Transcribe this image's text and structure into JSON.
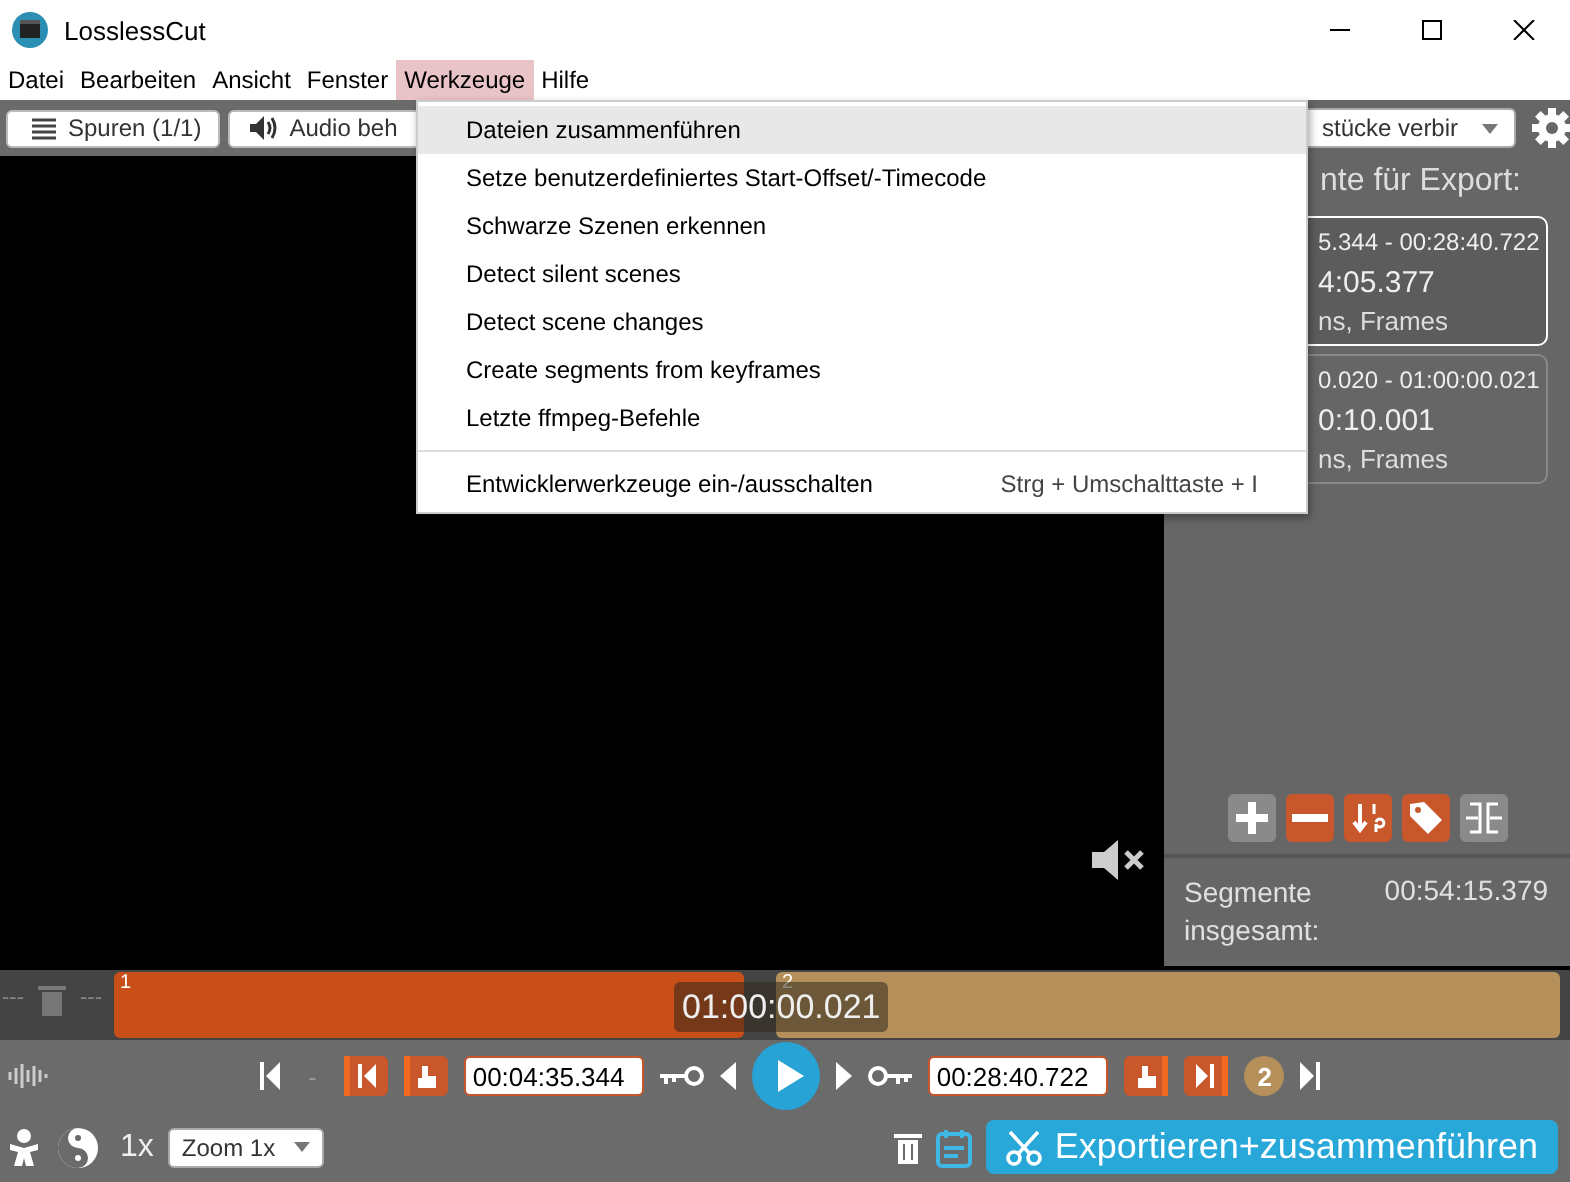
{
  "window": {
    "title": "LosslessCut"
  },
  "menu_bar": [
    {
      "label": "Datei",
      "selected": false
    },
    {
      "label": "Bearbeiten",
      "selected": false
    },
    {
      "label": "Ansicht",
      "selected": false
    },
    {
      "label": "Fenster",
      "selected": false
    },
    {
      "label": "Werkzeuge",
      "selected": true
    },
    {
      "label": "Hilfe",
      "selected": false
    }
  ],
  "toolbar": {
    "buttons": [
      "Spuren (1/1)",
      "Audio beh"
    ],
    "dropdown": "stücke verbir"
  },
  "dropdown_menu": [
    {
      "label": "Dateien zusammenführen",
      "selected": true,
      "separator_before": false
    },
    {
      "label": "Setze benutzerdefiniertes Start-Offset/-Timecode",
      "selected": false,
      "separator_before": false
    },
    {
      "label": "Schwarze Szenen erkennen",
      "selected": false,
      "separator_before": false
    },
    {
      "label": "Detect silent scenes",
      "selected": false,
      "separator_before": false
    },
    {
      "label": "Detect scene changes",
      "selected": false,
      "separator_before": false
    },
    {
      "label": "Create segments from keyframes",
      "selected": false,
      "separator_before": false
    },
    {
      "label": "Letzte ffmpeg-Befehle",
      "selected": false,
      "separator_before": false
    },
    {
      "label": "Entwicklerwerkzeuge ein-/ausschalten",
      "shortcut": "Strg + Umschalttaste + I",
      "selected": false,
      "separator_before": true
    }
  ],
  "sidebar": {
    "heading": "nte für Export:",
    "segments": [
      {
        "range": "5.344 - 00:28:40.722",
        "duration": "4:05.377",
        "note": "ns, Frames",
        "selected": true
      },
      {
        "range": "0.020 - 01:00:00.021",
        "duration": "0:10.001",
        "note": "ns, Frames",
        "selected": false
      }
    ],
    "total_label": "Segmente insgesamt:",
    "total": "00:54:15.379"
  },
  "timeline": {
    "dashes": [
      "---",
      "---"
    ],
    "segments": [
      {
        "label": "1",
        "color": "#c84f17"
      },
      {
        "label": "2",
        "color": "#b5905b"
      }
    ],
    "cursor_time": "01:00:00.021"
  },
  "controls": {
    "dash": "-",
    "start_time": "00:04:35.344",
    "end_time": "00:28:40.722",
    "segment_number": "2"
  },
  "bottom_bar": {
    "speed": "1x",
    "zoom": "Zoom 1x",
    "export_button": "Exportieren+zusammenführen"
  }
}
